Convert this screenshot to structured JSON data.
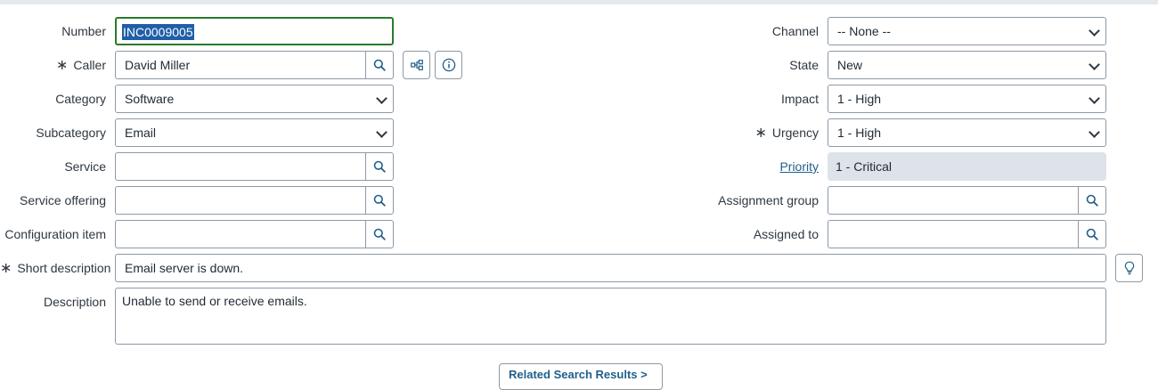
{
  "form": {
    "number": {
      "label": "Number",
      "value": "INC0009005"
    },
    "caller": {
      "label": "Caller",
      "value": "David Miller"
    },
    "category": {
      "label": "Category",
      "value": "Software"
    },
    "subcategory": {
      "label": "Subcategory",
      "value": "Email"
    },
    "service": {
      "label": "Service",
      "value": ""
    },
    "service_offering": {
      "label": "Service offering",
      "value": ""
    },
    "configuration_item": {
      "label": "Configuration item",
      "value": ""
    },
    "short_description": {
      "label": "Short description",
      "value": "Email server is down."
    },
    "description": {
      "label": "Description",
      "value": "Unable to send or receive emails."
    },
    "channel": {
      "label": "Channel",
      "value": "-- None --"
    },
    "state": {
      "label": "State",
      "value": "New"
    },
    "impact": {
      "label": "Impact",
      "value": "1 - High"
    },
    "urgency": {
      "label": "Urgency",
      "value": "1 - High"
    },
    "priority": {
      "label": "Priority",
      "value": "1 - Critical"
    },
    "assignment_group": {
      "label": "Assignment group",
      "value": ""
    },
    "assigned_to": {
      "label": "Assigned to",
      "value": ""
    }
  },
  "required_marker": "∗",
  "icons": {
    "lookup": "search-icon",
    "tree": "hierarchy-icon",
    "info": "info-icon",
    "suggest": "lightbulb-icon",
    "dropdown": "chevron-down-icon"
  },
  "bottom_button": {
    "label": "Related Search Results >"
  },
  "colors": {
    "accent": "#1f5f8b",
    "focus": "#2b7a2b",
    "selection": "#1f5fa8",
    "readonly": "#dde3e8"
  }
}
